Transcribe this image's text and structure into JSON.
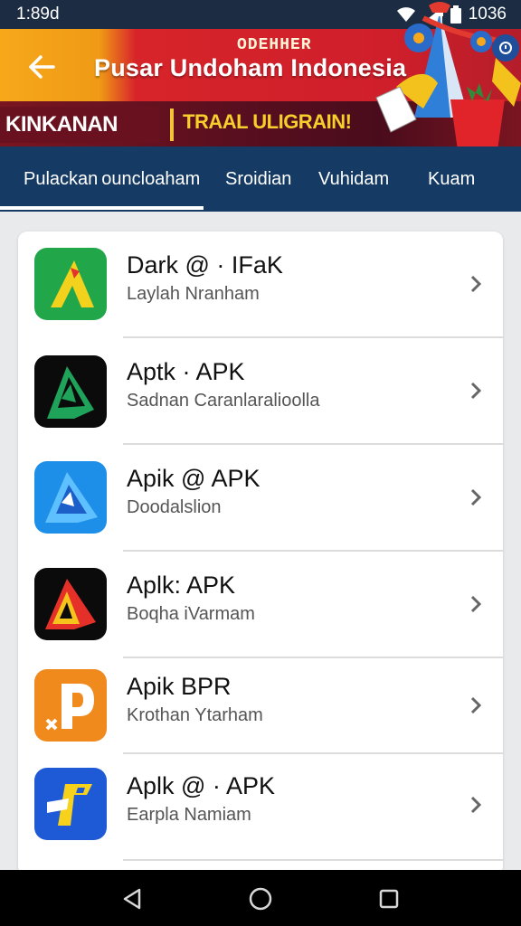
{
  "status_bar": {
    "time": "1:89d",
    "clock": "1036"
  },
  "header": {
    "brand_tag": "ODEHHER",
    "title": "Pusar Undoham Indonesia",
    "promo_left": "KINKANAN",
    "promo_right": "TRAAL ULIGRAIN!"
  },
  "tabs": [
    {
      "label": "Pulackan ouncloaham"
    },
    {
      "label": "Sroidian"
    },
    {
      "label": "Vuhidam"
    },
    {
      "label": "Kuam"
    }
  ],
  "apps": [
    {
      "name": "Dark @ · IFaK",
      "subtitle": "Laylah Nranham",
      "icon": "green-yellow-app-icon"
    },
    {
      "name": "Aptk · APK",
      "subtitle": "Sadnan Caranlaralioolla",
      "icon": "black-green-app-icon"
    },
    {
      "name": "Apik @ APK",
      "subtitle": "Doodalslion",
      "icon": "blue-app-icon"
    },
    {
      "name": "Aplk: APK",
      "subtitle": "Boqha iVarmam",
      "icon": "black-red-app-icon"
    },
    {
      "name": "Apik BPR",
      "subtitle": "Krothan Ytarham",
      "icon": "orange-p-app-icon"
    },
    {
      "name": "Aplk @ · APK",
      "subtitle": "Earpla Namiam",
      "icon": "blue-yellow-app-icon"
    }
  ],
  "colors": {
    "status_bar": "#1b2c43",
    "tab_bar": "#153a63",
    "banner_red": "#cf1f2b",
    "banner_orange": "#f6a81a",
    "badge_red": "#d42a2a"
  }
}
